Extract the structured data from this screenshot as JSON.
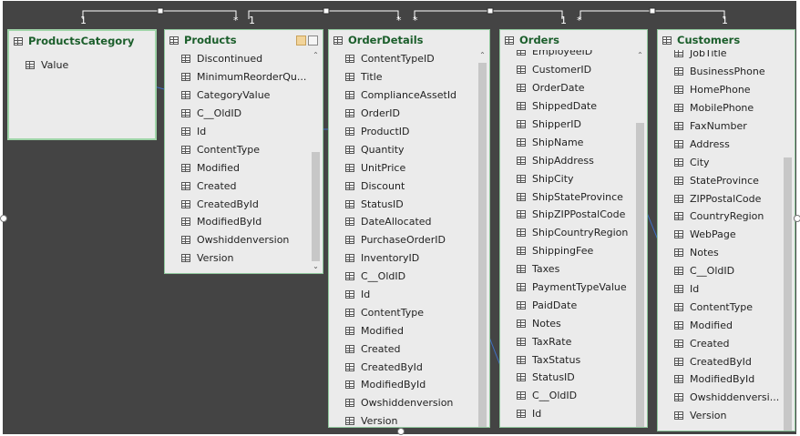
{
  "cardinality": {
    "rel1_one": "1",
    "rel1_many": "*",
    "rel2_one": "1",
    "rel2_many": "*",
    "rel3_many": "*",
    "rel3_one": "1",
    "rel4_many": "*",
    "rel4_one": "1"
  },
  "tables": {
    "productsCategory": {
      "title": "ProductsCategory",
      "fields": [
        "Value"
      ]
    },
    "products": {
      "title": "Products",
      "fields": [
        "Discontinued",
        "MinimumReorderQu...",
        "CategoryValue",
        "C__OldID",
        "Id",
        "ContentType",
        "Modified",
        "Created",
        "CreatedById",
        "ModifiedById",
        "Owshiddenversion",
        "Version"
      ]
    },
    "orderDetails": {
      "title": "OrderDetails",
      "fields": [
        "ContentTypeID",
        "Title",
        "ComplianceAssetId",
        "OrderID",
        "ProductID",
        "Quantity",
        "UnitPrice",
        "Discount",
        "StatusID",
        "DateAllocated",
        "PurchaseOrderID",
        "InventoryID",
        "C__OldID",
        "Id",
        "ContentType",
        "Modified",
        "Created",
        "CreatedById",
        "ModifiedById",
        "Owshiddenversion",
        "Version"
      ]
    },
    "orders": {
      "title": "Orders",
      "fields": [
        "EmployeeID",
        "CustomerID",
        "OrderDate",
        "ShippedDate",
        "ShipperID",
        "ShipName",
        "ShipAddress",
        "ShipCity",
        "ShipStateProvince",
        "ShipZIPPostalCode",
        "ShipCountryRegion",
        "ShippingFee",
        "Taxes",
        "PaymentTypeValue",
        "PaidDate",
        "Notes",
        "TaxRate",
        "TaxStatus",
        "StatusID",
        "C__OldID",
        "Id"
      ]
    },
    "customers": {
      "title": "Customers",
      "fields": [
        "JobTitle",
        "BusinessPhone",
        "HomePhone",
        "MobilePhone",
        "FaxNumber",
        "Address",
        "City",
        "StateProvince",
        "ZIPPostalCode",
        "CountryRegion",
        "WebPage",
        "Notes",
        "C__OldID",
        "Id",
        "ContentType",
        "Modified",
        "Created",
        "CreatedById",
        "ModifiedById",
        "Owshiddenversi...",
        "Version"
      ]
    }
  },
  "colors": {
    "canvas": "#444444",
    "card": "#ebebeb",
    "cardBorder": "#8fc79c",
    "title": "#1b5e2b",
    "relLine": "#3f6fc4"
  }
}
